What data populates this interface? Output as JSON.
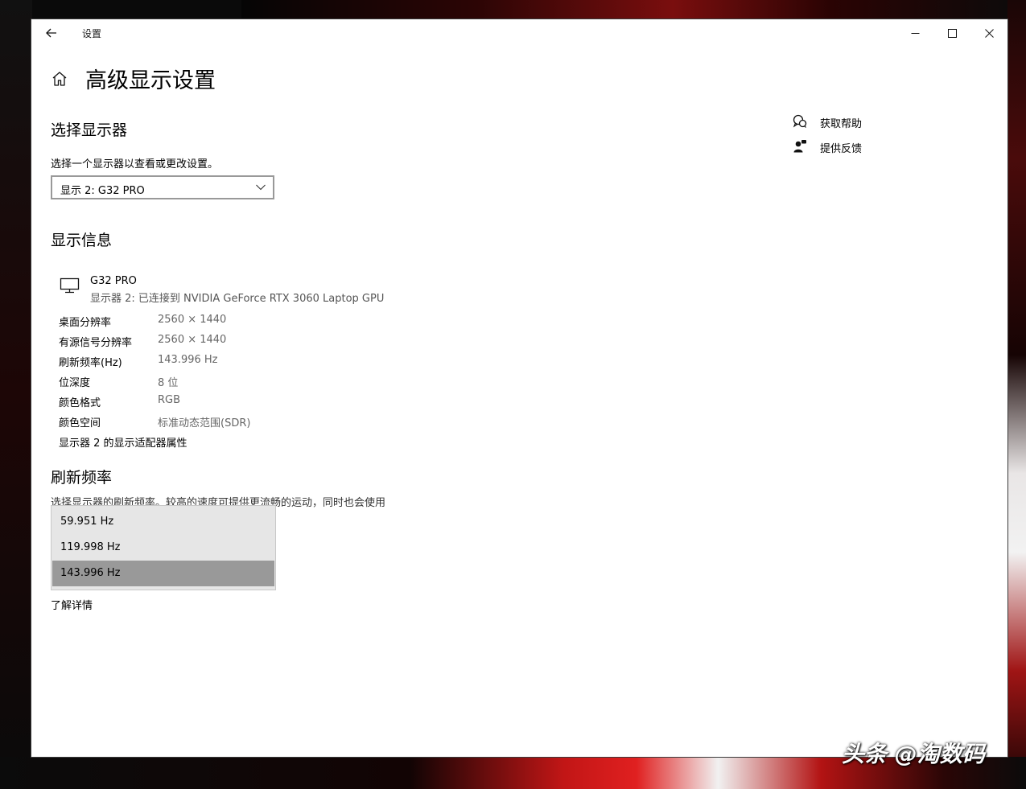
{
  "window": {
    "title": "设置"
  },
  "page": {
    "title": "高级显示设置"
  },
  "select_display": {
    "heading": "选择显示器",
    "instruction": "选择一个显示器以查看或更改设置。",
    "selected": "显示 2: G32 PRO"
  },
  "display_info": {
    "heading": "显示信息",
    "monitor_name": "G32 PRO",
    "monitor_subtitle": "显示器 2: 已连接到 NVIDIA GeForce RTX 3060 Laptop GPU",
    "rows": [
      {
        "label": "桌面分辨率",
        "value": "2560 × 1440"
      },
      {
        "label": "有源信号分辨率",
        "value": "2560 × 1440"
      },
      {
        "label": "刷新频率(Hz)",
        "value": "143.996 Hz"
      },
      {
        "label": "位深度",
        "value": "8 位"
      },
      {
        "label": "颜色格式",
        "value": "RGB"
      },
      {
        "label": "颜色空间",
        "value": "标准动态范围(SDR)"
      }
    ],
    "adapter_link": "显示器 2 的显示适配器属性"
  },
  "refresh_rate": {
    "heading": "刷新频率",
    "description": "选择显示器的刷新频率。较高的速度可提供更流畅的运动，同时也会使用",
    "options": [
      "59.951 Hz",
      "119.998 Hz",
      "143.996 Hz"
    ],
    "selected_index": 2,
    "learn_more": "了解详情"
  },
  "help": {
    "get_help": "获取帮助",
    "feedback": "提供反馈"
  },
  "watermark": "头条 @淘数码"
}
